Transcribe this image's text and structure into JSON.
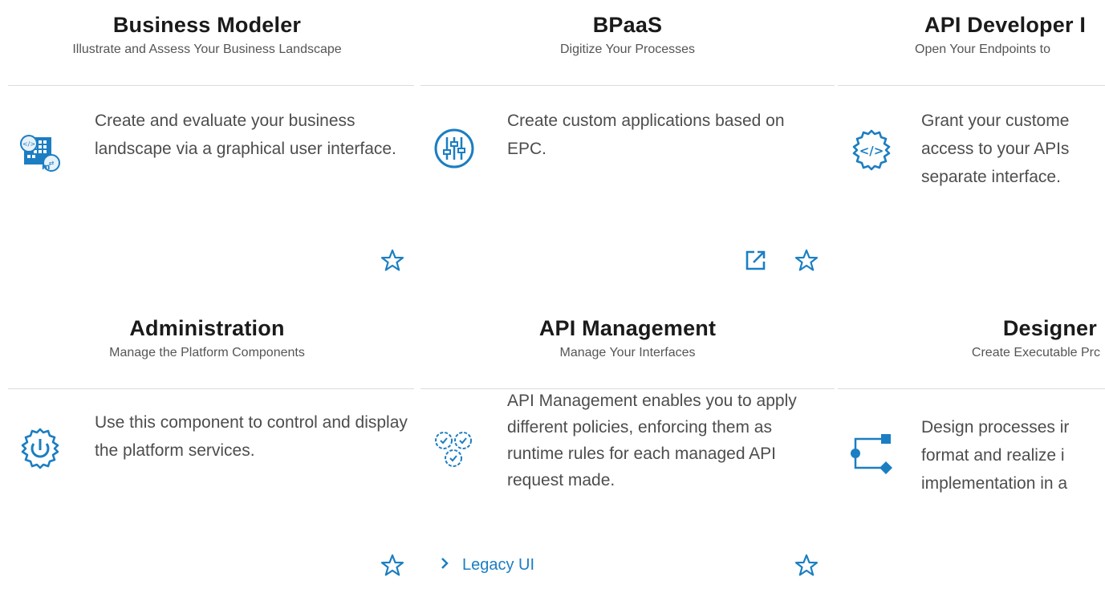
{
  "colors": {
    "accent": "#1b7ec2",
    "title": "#1a1a1a",
    "subtitle": "#555555",
    "description": "#4d4d4d",
    "divider": "#dcdcdc"
  },
  "tiles": [
    {
      "title": "Business Modeler",
      "subtitle": "Illustrate and Assess Your Business Landscape",
      "description": "Create and evaluate your business landscape via a graphical user interface.",
      "icon": "business-modeler-icon",
      "actions": [
        "favorite-star-icon"
      ]
    },
    {
      "title": "BPaaS",
      "subtitle": "Digitize Your Processes",
      "description": "Create custom applications based on EPC.",
      "icon": "sliders-icon",
      "actions": [
        "open-external-icon",
        "favorite-star-icon"
      ]
    },
    {
      "title": "API Developer I",
      "subtitle": "Open Your Endpoints to",
      "description": "Grant your custome access to your APIs separate interface.",
      "icon": "code-gear-icon",
      "actions": []
    },
    {
      "title": "Administration",
      "subtitle": "Manage the Platform Components",
      "description": "Use this component to control and display the platform services.",
      "icon": "power-gear-icon",
      "actions": [
        "favorite-star-icon"
      ]
    },
    {
      "title": "API Management",
      "subtitle": "Manage Your Interfaces",
      "description": "API Management enables you to apply different policies, enforcing them as runtime rules for each managed API request made.",
      "icon": "gears-check-icon",
      "actions": [
        "favorite-star-icon"
      ],
      "link": "Legacy UI"
    },
    {
      "title": "Designer",
      "subtitle": "Create Executable Prc",
      "description": "Design processes ir format and realize i implementation in a",
      "icon": "flow-icon",
      "actions": []
    }
  ]
}
